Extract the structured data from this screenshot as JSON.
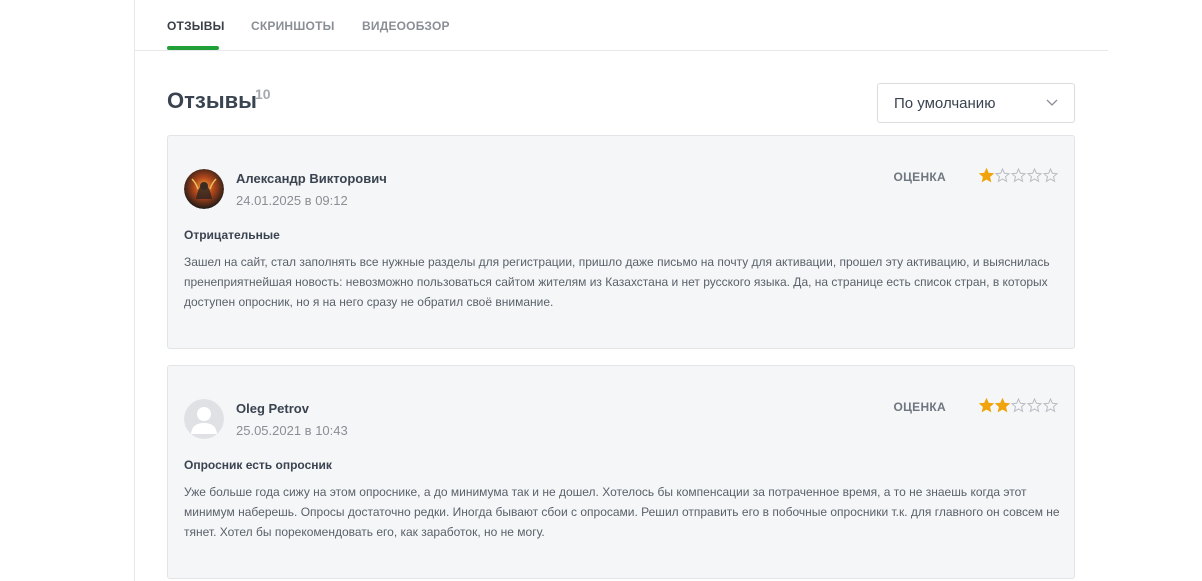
{
  "tabs": [
    {
      "label": "ОТЗЫВЫ",
      "active": true
    },
    {
      "label": "СКРИНШОТЫ",
      "active": false
    },
    {
      "label": "ВИДЕООБЗОР",
      "active": false
    }
  ],
  "section": {
    "title": "Отзывы",
    "count": "10"
  },
  "sort": {
    "selected": "По умолчанию"
  },
  "colors": {
    "accent": "#21a038",
    "star_filled": "#f0a30a",
    "star_empty": "#b8bcc2"
  },
  "reviews": [
    {
      "author": "Александр Викторович",
      "date": "24.01.2025 в 09:12",
      "rating_label": "ОЦЕНКА",
      "rating": 1,
      "rating_max": 5,
      "title": "Отрицательные",
      "text": "Зашел на сайт, стал заполнять все нужные разделы для регистрации, пришло даже письмо на почту для активации, прошел эту активацию, и выяснилась пренеприятнейшая новость: невозможно пользоваться сайтом жителям из Казахстана и нет русского языка. Да, на странице есть список стран, в которых доступен опросник, но я на него сразу не обратил своё внимание.",
      "avatar_icon": "avatar-photo-icon"
    },
    {
      "author": "Oleg Petrov",
      "date": "25.05.2021 в 10:43",
      "rating_label": "ОЦЕНКА",
      "rating": 2,
      "rating_max": 5,
      "title": "Опросник есть опросник",
      "text": "Уже больше года сижу на этом опроснике, а до минимума так и не дошел. Хотелось бы компенсации за потраченное время, а то не знаешь когда этот минимум наберешь. Опросы достаточно редки. Иногда бывают сбои с опросами. Решил отправить его в побочные опросники т.к. для главного он совсем не тянет. Хотел бы порекомендовать его, как заработок, но не могу.",
      "avatar_icon": "default-user-icon"
    }
  ]
}
